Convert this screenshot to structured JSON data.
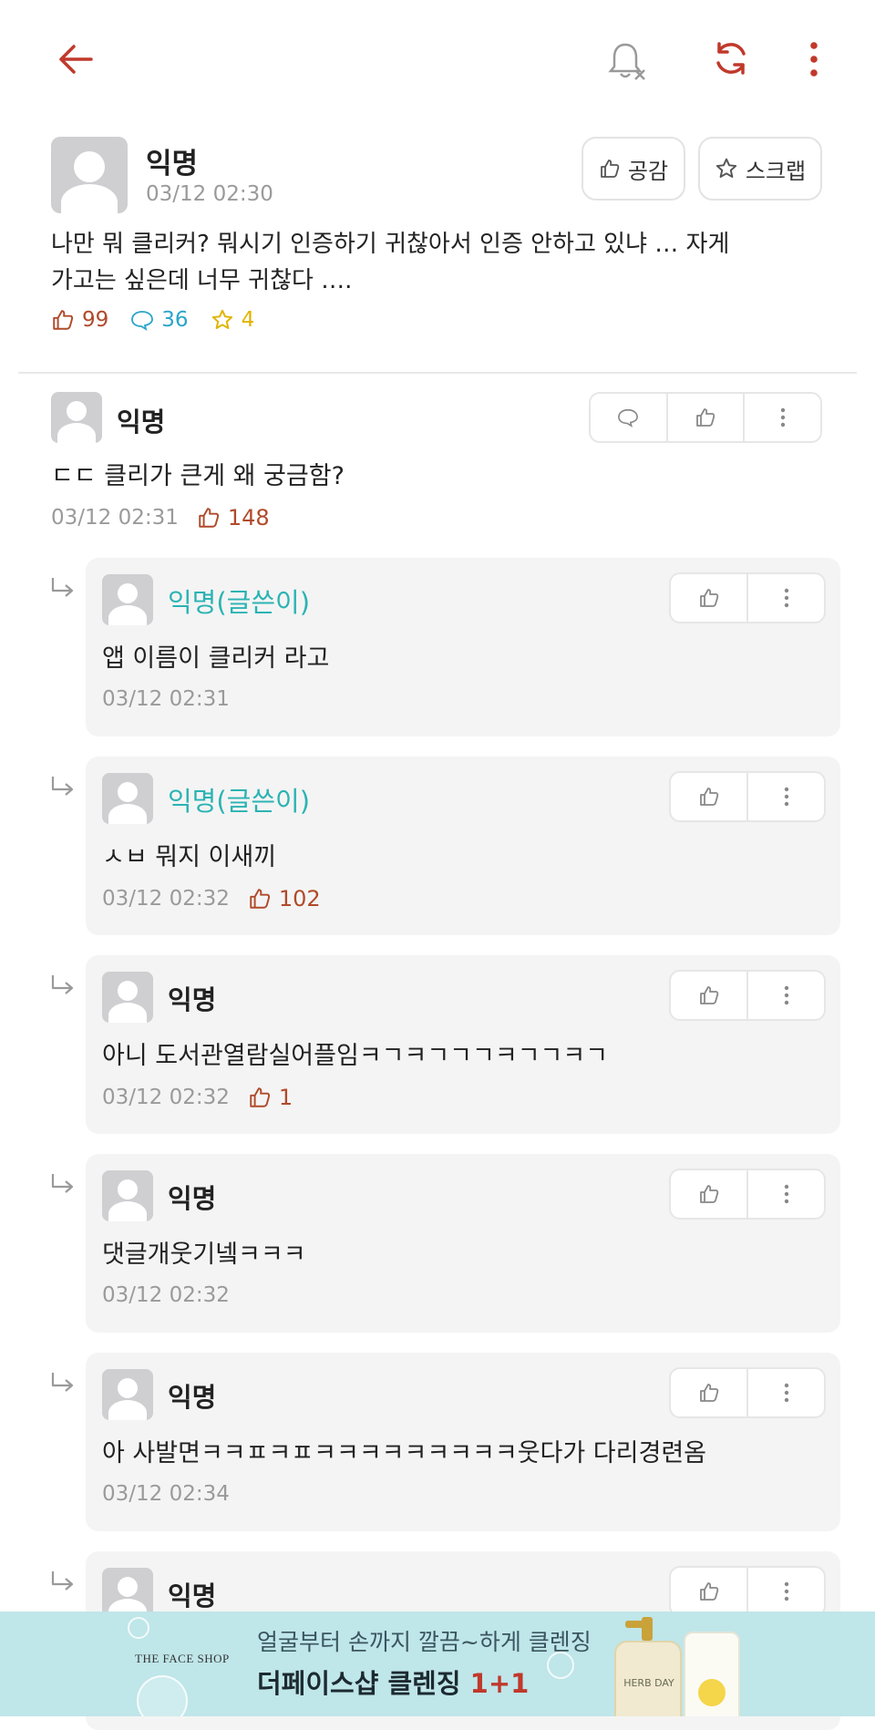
{
  "topbar": {
    "icons": [
      "back-arrow-icon",
      "bell-off-icon",
      "refresh-icon",
      "more-vertical-icon"
    ],
    "accent": "#c0392b"
  },
  "post": {
    "author": "익명",
    "time": "03/12 02:30",
    "empathy_label": "공감",
    "scrap_label": "스크랩",
    "body_line1": "나만 뭐 클리커?  뭐시기 인증하기 귀찮아서 인증 안하고 있냐 … 자게",
    "body_line2": "가고는 싶은데 너무 귀찮다 ….",
    "likes": "99",
    "comments": "36",
    "scraps": "4"
  },
  "comment": {
    "author": "익명",
    "text": "ㄷㄷ 클리가 큰게 왜 궁금함?",
    "time": "03/12 02:31",
    "likes": "148"
  },
  "replies": [
    {
      "author": "익명(글쓴이)",
      "op": true,
      "text": "앱 이름이 클리커 라고",
      "time": "03/12 02:31",
      "likes": ""
    },
    {
      "author": "익명(글쓴이)",
      "op": true,
      "text": "ㅅㅂ 뭐지 이새끼",
      "time": "03/12 02:32",
      "likes": "102"
    },
    {
      "author": "익명",
      "op": false,
      "text": "아니 도서관열람실어플임ㅋㄱㅋㄱㄱㄱㅋㄱㄱㅋㄱ",
      "time": "03/12 02:32",
      "likes": "1"
    },
    {
      "author": "익명",
      "op": false,
      "text": "댓글개웃기넼ㅋㅋㅋ",
      "time": "03/12 02:32",
      "likes": ""
    },
    {
      "author": "익명",
      "op": false,
      "text": "아 사발면ㅋㅋㅍㅋㅍㅋㅋㅋㅋㅋㅋㅋㅋㅋ웃다가 다리경련옴",
      "time": "03/12 02:34",
      "likes": ""
    },
    {
      "author": "익명",
      "op": false,
      "text": "",
      "time": "",
      "likes": ""
    }
  ],
  "ad": {
    "brand": "THE FACE SHOP",
    "line1": "얼굴부터 손까지 깔끔~하게 클렌징",
    "line2": "더페이스샵 클렌징 ",
    "line2_accent": "1+1",
    "bottle_label": "HERB DAY"
  }
}
